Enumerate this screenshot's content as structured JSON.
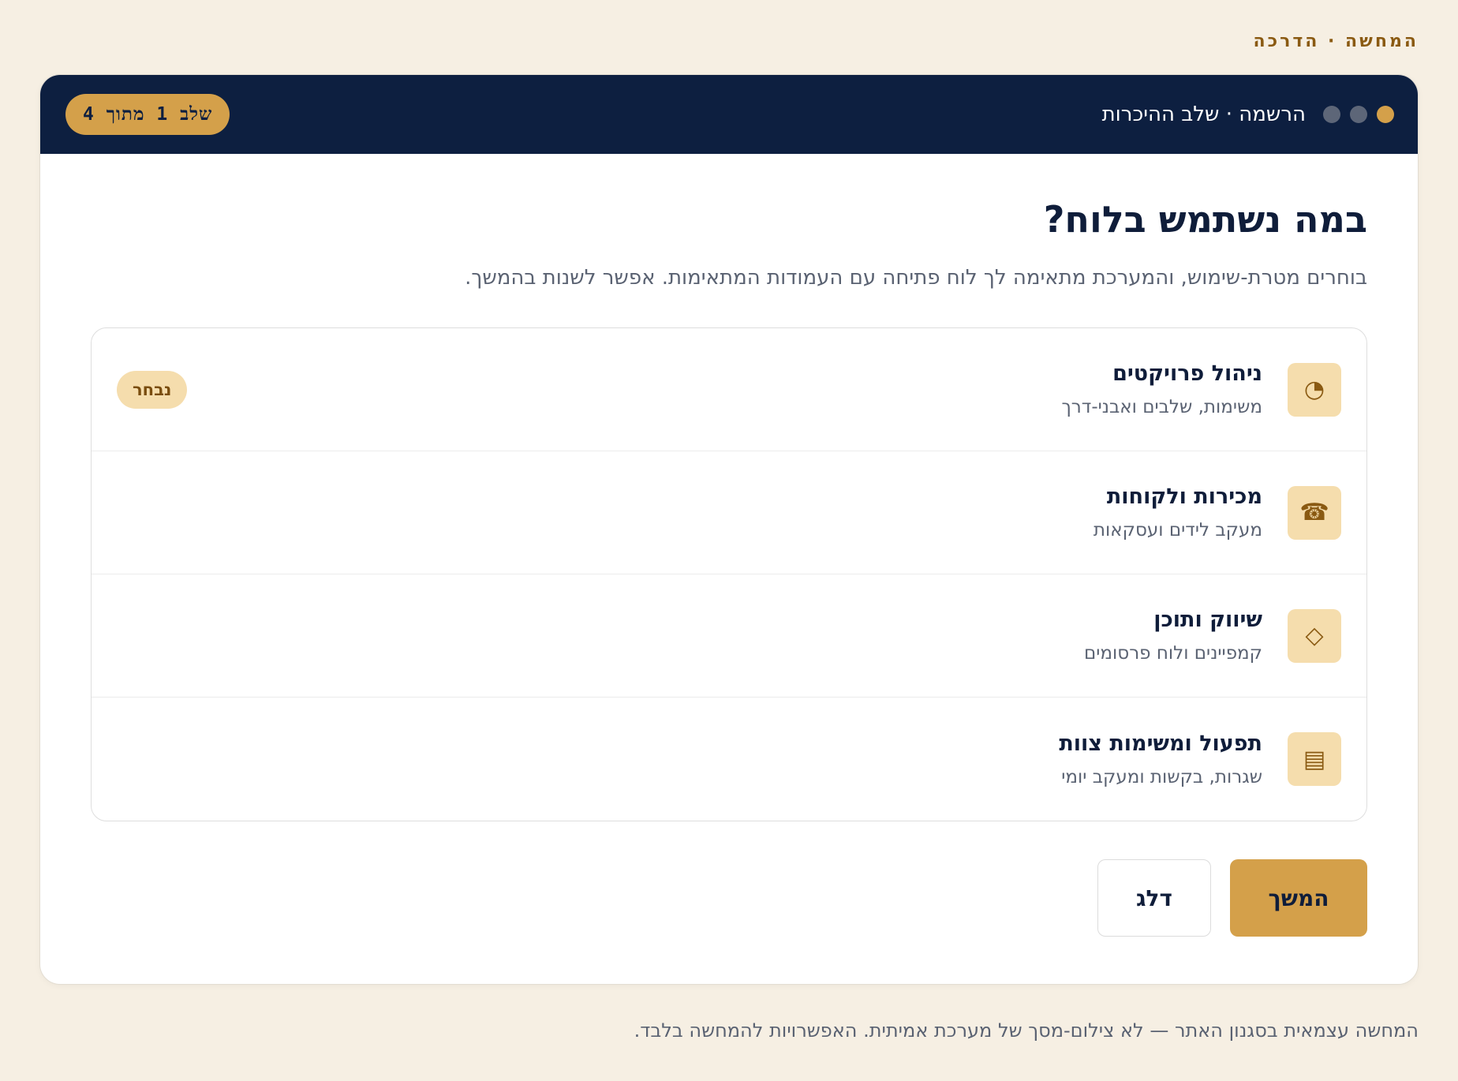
{
  "top_caption": "המחשה · הדרכה",
  "header": {
    "title": "הרשמה · שלב ההיכרות",
    "step_label": "שלב 1 מתוך 4",
    "dots_total": 3,
    "dots_active_index": 0
  },
  "main": {
    "title": "במה נשתמש בלוח?",
    "subtitle": "בוחרים מטרת-שימוש, והמערכת מתאימה לך לוח פתיחה עם העמודות המתאימות. אפשר לשנות בהמשך."
  },
  "options": [
    {
      "title": "ניהול פרויקטים",
      "desc": "משימות, שלבים ואבני-דרך",
      "icon_name": "pie-chart-icon",
      "icon_glyph": "◔",
      "selected": true,
      "badge": "נבחר"
    },
    {
      "title": "מכירות ולקוחות",
      "desc": "מעקב לידים ועסקאות",
      "icon_name": "telephone-icon",
      "icon_glyph": "☎",
      "selected": false
    },
    {
      "title": "שיווק ותוכן",
      "desc": "קמפיינים ולוח פרסומים",
      "icon_name": "diamond-icon",
      "icon_glyph": "◇",
      "selected": false
    },
    {
      "title": "תפעול ומשימות צוות",
      "desc": "שגרות, בקשות ומעקב יומי",
      "icon_name": "list-icon",
      "icon_glyph": "▤",
      "selected": false
    }
  ],
  "actions": {
    "continue_label": "המשך",
    "skip_label": "דלג"
  },
  "footnote": "המחשה עצמאית בסגנון האתר — לא צילום-מסך של מערכת אמיתית. האפשרויות להמחשה בלבד.",
  "colors": {
    "navy": "#0d1f40",
    "gold": "#d4a04a",
    "gold_light": "#f5ddad",
    "background": "#f6efe3"
  }
}
